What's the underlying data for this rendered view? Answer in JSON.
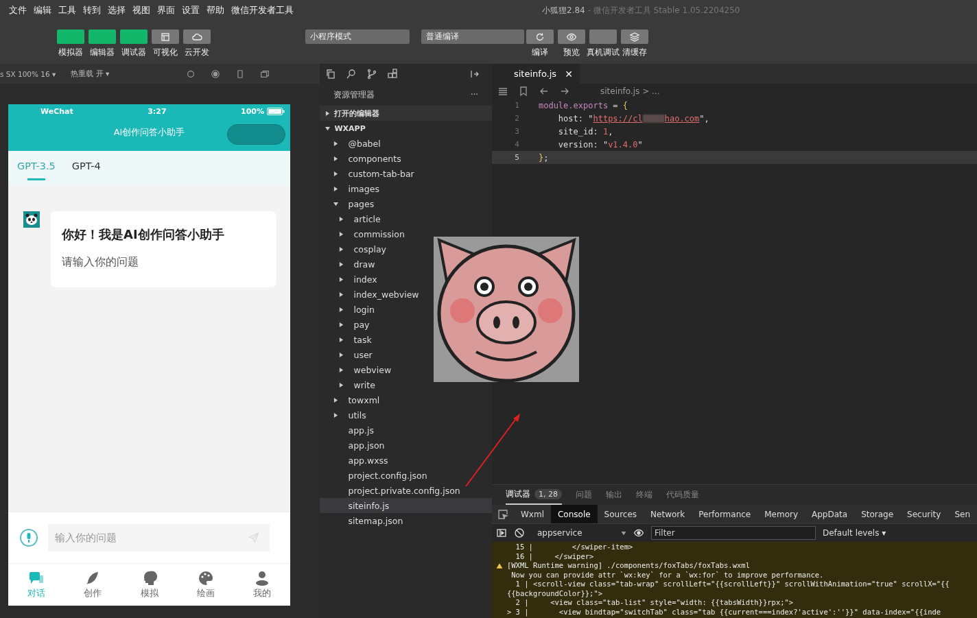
{
  "menu": [
    "文件",
    "编辑",
    "工具",
    "转到",
    "选择",
    "视图",
    "界面",
    "设置",
    "帮助",
    "微信开发者工具"
  ],
  "window_title": {
    "project": "小狐狸2.84",
    "app": "- 微信开发者工具 Stable 1.05.2204250"
  },
  "toolbar": {
    "left": [
      {
        "label": "模拟器",
        "on": true
      },
      {
        "label": "编辑器",
        "on": true
      },
      {
        "label": "调试器",
        "on": true
      },
      {
        "label": "可视化",
        "on": false
      },
      {
        "label": "云开发",
        "on": false
      }
    ],
    "mode_select": "小程序模式",
    "compile_select": "普通编译",
    "right": [
      {
        "label": "编译"
      },
      {
        "label": "预览"
      },
      {
        "label": "真机调试"
      },
      {
        "label": "清缓存"
      }
    ]
  },
  "simulator": {
    "device": "s SX 100% 16 ▾",
    "hot_reload": "热重载 开 ▾",
    "phone": {
      "carrier": "WeChat",
      "time": "3:27",
      "battery": "100%",
      "title": "AI创作问答小助手",
      "tabs": [
        {
          "label": "GPT-3.5",
          "selected": true
        },
        {
          "label": "GPT-4",
          "selected": false
        }
      ],
      "message": {
        "title": "你好！我是AI创作问答小助手",
        "body": "请输入你的问题"
      },
      "input": {
        "placeholder": "输入你的问题"
      },
      "tabbar": [
        {
          "label": "对话",
          "selected": true
        },
        {
          "label": "创作",
          "selected": false
        },
        {
          "label": "模拟",
          "selected": false
        },
        {
          "label": "绘画",
          "selected": false
        },
        {
          "label": "我的",
          "selected": false
        }
      ]
    }
  },
  "explorer": {
    "title": "资源管理器",
    "more": "···",
    "sections": [
      {
        "label": "打开的编辑器",
        "expanded": false
      },
      {
        "label": "WXAPP",
        "expanded": true
      }
    ],
    "tree": [
      {
        "name": "@babel",
        "kind": "folder",
        "expanded": false,
        "selected": false
      },
      {
        "name": "components",
        "kind": "folder",
        "expanded": false,
        "selected": false
      },
      {
        "name": "custom-tab-bar",
        "kind": "folder",
        "expanded": false,
        "selected": false
      },
      {
        "name": "images",
        "kind": "folder",
        "expanded": false,
        "selected": false
      },
      {
        "name": "pages",
        "kind": "folder",
        "expanded": true,
        "selected": false,
        "children": [
          {
            "name": "article",
            "kind": "folder",
            "expanded": false,
            "selected": false
          },
          {
            "name": "commission",
            "kind": "folder",
            "expanded": false,
            "selected": false
          },
          {
            "name": "cosplay",
            "kind": "folder",
            "expanded": false,
            "selected": false
          },
          {
            "name": "draw",
            "kind": "folder",
            "expanded": false,
            "selected": false
          },
          {
            "name": "index",
            "kind": "folder",
            "expanded": false,
            "selected": false
          },
          {
            "name": "index_webview",
            "kind": "folder",
            "expanded": false,
            "selected": false
          },
          {
            "name": "login",
            "kind": "folder",
            "expanded": false,
            "selected": false
          },
          {
            "name": "pay",
            "kind": "folder",
            "expanded": false,
            "selected": false
          },
          {
            "name": "task",
            "kind": "folder",
            "expanded": false,
            "selected": false
          },
          {
            "name": "user",
            "kind": "folder",
            "expanded": false,
            "selected": false
          },
          {
            "name": "webview",
            "kind": "folder",
            "expanded": false,
            "selected": false
          },
          {
            "name": "write",
            "kind": "folder",
            "expanded": false,
            "selected": false
          }
        ]
      },
      {
        "name": "towxml",
        "kind": "folder",
        "expanded": false,
        "selected": false
      },
      {
        "name": "utils",
        "kind": "folder",
        "expanded": false,
        "selected": false
      },
      {
        "name": "app.js",
        "kind": "file",
        "selected": false
      },
      {
        "name": "app.json",
        "kind": "file",
        "selected": false
      },
      {
        "name": "app.wxss",
        "kind": "file",
        "selected": false
      },
      {
        "name": "project.config.json",
        "kind": "file",
        "selected": false
      },
      {
        "name": "project.private.config.json",
        "kind": "file",
        "selected": false
      },
      {
        "name": "siteinfo.js",
        "kind": "file",
        "selected": true
      },
      {
        "name": "sitemap.json",
        "kind": "file",
        "selected": false
      }
    ]
  },
  "editor": {
    "tab": {
      "label": "siteinfo.js",
      "close": "✕"
    },
    "breadcrumb": "siteinfo.js > ...",
    "lines": [
      {
        "num": "1",
        "current": false,
        "tokens": [
          {
            "kind": "prop",
            "t": "module.exports"
          },
          {
            "kind": "plain",
            "t": " = "
          },
          {
            "kind": "brace",
            "t": "{"
          }
        ]
      },
      {
        "num": "2",
        "current": false,
        "tokens": [
          {
            "kind": "plain",
            "t": "    host: \""
          },
          {
            "kind": "link",
            "t": "https://cl"
          },
          {
            "kind": "redacted"
          },
          {
            "kind": "link",
            "t": "hao.com"
          },
          {
            "kind": "plain",
            "t": "\","
          }
        ]
      },
      {
        "num": "3",
        "current": false,
        "tokens": [
          {
            "kind": "plain",
            "t": "    site_id: "
          },
          {
            "kind": "number",
            "t": "1"
          },
          {
            "kind": "plain",
            "t": ","
          }
        ]
      },
      {
        "num": "4",
        "current": false,
        "tokens": [
          {
            "kind": "plain",
            "t": "    version: \""
          },
          {
            "kind": "string",
            "t": "v1.4.0"
          },
          {
            "kind": "plain",
            "t": "\""
          }
        ]
      },
      {
        "num": "5",
        "current": true,
        "tokens": [
          {
            "kind": "brace",
            "t": "}"
          },
          {
            "kind": "plain",
            "t": ";"
          }
        ]
      }
    ]
  },
  "debugger": {
    "tabs": [
      {
        "label": "调试器",
        "selected": true,
        "badge": "1, 28"
      },
      {
        "label": "问题",
        "selected": false
      },
      {
        "label": "输出",
        "selected": false
      },
      {
        "label": "终端",
        "selected": false
      },
      {
        "label": "代码质量",
        "selected": false
      }
    ],
    "devtools_tabs": [
      {
        "label": "Wxml",
        "selected": false
      },
      {
        "label": "Console",
        "selected": true
      },
      {
        "label": "Sources",
        "selected": false
      },
      {
        "label": "Network",
        "selected": false
      },
      {
        "label": "Performance",
        "selected": false
      },
      {
        "label": "Memory",
        "selected": false
      },
      {
        "label": "AppData",
        "selected": false
      },
      {
        "label": "Storage",
        "selected": false
      },
      {
        "label": "Security",
        "selected": false
      },
      {
        "label": "Sen",
        "selected": false
      }
    ],
    "context": "appservice",
    "filter_placeholder": "Filter",
    "levels": "Default levels ▾",
    "console": [
      {
        "kind": "code",
        "text": "  15 |         </swiper-item>"
      },
      {
        "kind": "code",
        "text": "  16 |     </swiper>"
      },
      {
        "kind": "warning",
        "text": "[WXML Runtime warning] ./components/foxTabs/foxTabs.wxml"
      },
      {
        "kind": "code",
        "text": " Now you can provide attr `wx:key` for a `wx:for` to improve performance."
      },
      {
        "kind": "code",
        "text": "  1 | <scroll-view class=\"tab-wrap\" scrollLeft=\"{{scrollLeft}}\" scrollWithAnimation=\"true\" scrollX=\"{{"
      },
      {
        "kind": "code",
        "text": "{{backgroundColor}};\">"
      },
      {
        "kind": "code",
        "text": "  2 |     <view class=\"tab-list\" style=\"width: {{tabsWidth}}rpx;\">"
      },
      {
        "kind": "code",
        "text": "> 3 |       <view bindtap=\"switchTab\" class=\"tab {{current===index?'active':''}}\" data-index=\"{{inde"
      }
    ]
  }
}
